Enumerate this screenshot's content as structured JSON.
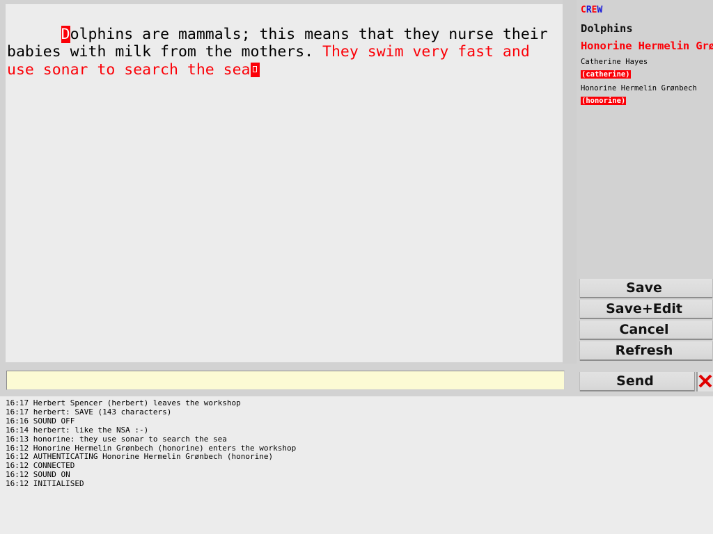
{
  "editor": {
    "segments": [
      {
        "style": "cursor-char",
        "text": "D"
      },
      {
        "style": "black",
        "text": "olphins are mammals; this means that they nurse their babies with milk from the mothers. "
      },
      {
        "style": "red",
        "text": "They swim very fast and use sonar to search the sea"
      },
      {
        "style": "block-cursor",
        "text": ""
      }
    ],
    "plain_text": "Dolphins are mammals; this means that they nurse their babies with milk from the mothers. They swim very fast and use sonar to search the sea"
  },
  "sidebar": {
    "crew_label": "CREW",
    "crew_label_colors": {
      "red": "#fb0007",
      "blue": "#1414d8"
    },
    "room_title": "Dolphins",
    "active_user": "Honorine Hermelin Grønbech",
    "crew": [
      {
        "name": "Catherine Hayes",
        "handle": "(catherine)"
      },
      {
        "name": "Honorine Hermelin Grønbech",
        "handle": "(honorine)"
      }
    ]
  },
  "buttons": {
    "save": "Save",
    "save_edit": "Save+Edit",
    "cancel": "Cancel",
    "refresh": "Refresh"
  },
  "chat": {
    "input_value": "",
    "input_placeholder": "",
    "send_label": "Send",
    "close_icon": "red-x-close-icon"
  },
  "log": {
    "lines": [
      "16:17 Herbert Spencer (herbert) leaves the workshop",
      "16:17 herbert: SAVE (143 characters)",
      "16:16 SOUND OFF",
      "16:14 herbert: like the NSA :-)",
      "16:13 honorine: they use sonar to search the sea",
      "16:12 Honorine Hermelin Grønbech (honorine) enters the workshop",
      "16:12 AUTHENTICATING Honorine Hermelin Grønbech (honorine)",
      "16:12 CONNECTED",
      "16:12 SOUND ON",
      "16:12 INITIALISED"
    ]
  },
  "colors": {
    "accent_red": "#fb0007",
    "accent_blue": "#1414d8",
    "window_bg": "#d2d2d2",
    "pane_bg": "#ececec",
    "input_bg": "#fcfbd4"
  }
}
